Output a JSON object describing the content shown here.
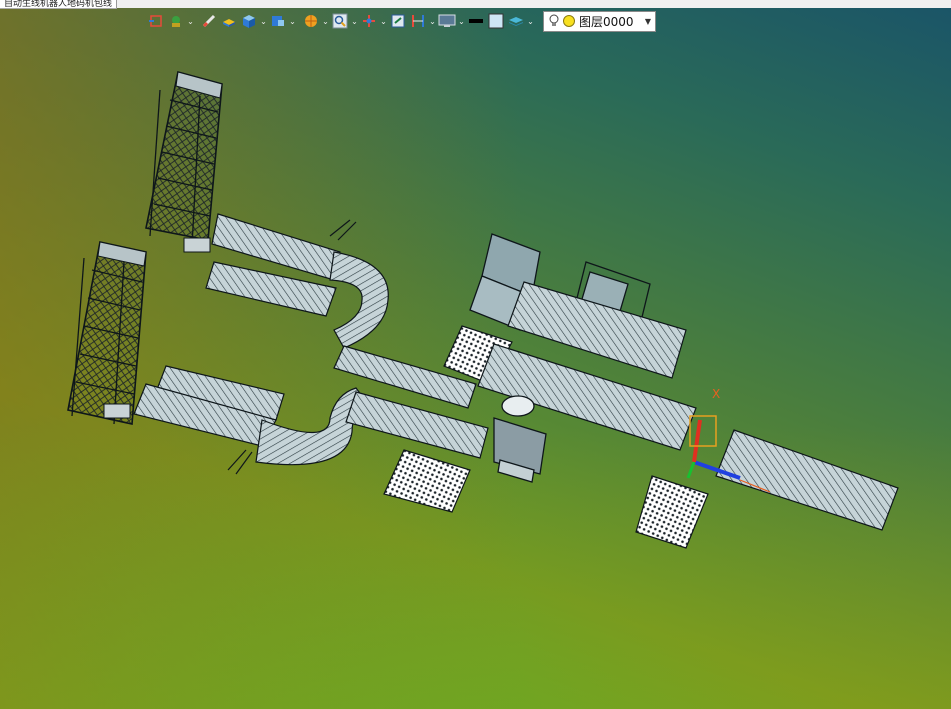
{
  "document_tab": {
    "title": "自动生线机器人地码机包线"
  },
  "toolbar": {
    "buttons": [
      {
        "name": "view-orient-icon"
      },
      {
        "name": "snap-tool-icon",
        "caret": true
      },
      {
        "name": "pen-icon"
      },
      {
        "name": "block-icon"
      },
      {
        "name": "cube-icon",
        "caret": true
      },
      {
        "name": "cube-stack-icon",
        "caret": true
      },
      {
        "name": "render-icon",
        "caret": true
      },
      {
        "name": "zoom-icon",
        "caret": true
      },
      {
        "name": "axis-icon",
        "caret": true
      },
      {
        "name": "export-icon"
      },
      {
        "name": "section-icon",
        "caret": true
      },
      {
        "name": "monitor-icon",
        "caret": true
      },
      {
        "name": "line-color-icon"
      },
      {
        "name": "fill-color-icon"
      },
      {
        "name": "layer-stack-icon",
        "caret": true
      }
    ],
    "layer": {
      "label": "图层0000"
    }
  },
  "scene": {
    "axis_label": "X",
    "colors": {
      "bg_top_right": "#1a5468",
      "bg_bottom_right": "#2dbd3d",
      "bg_left": "#9a7418",
      "model_line": "#101820",
      "model_fill": "#b8c8cc",
      "axis_x": "#e03020",
      "axis_y": "#18c030",
      "axis_z": "#2040e0"
    }
  }
}
